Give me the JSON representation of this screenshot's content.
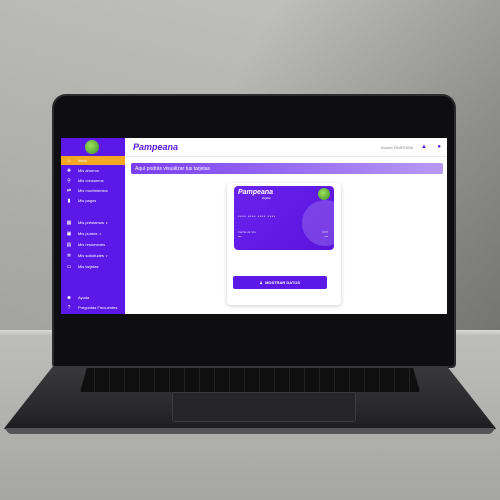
{
  "app": {
    "brand": "Pampeana",
    "user_name": "Usuario PAMPEANA"
  },
  "sidebar": {
    "items": [
      {
        "label": "Inicio",
        "icon": "home-icon",
        "glyph": "⌂",
        "caret": ""
      },
      {
        "label": "Mis ahorros",
        "icon": "piggy-icon",
        "glyph": "✚",
        "caret": ""
      },
      {
        "label": "Mis consumos",
        "icon": "search-icon",
        "glyph": "⚲",
        "caret": ""
      },
      {
        "label": "Mis movimientos",
        "icon": "transfer-icon",
        "glyph": "⇄",
        "caret": ""
      },
      {
        "label": "Mis pagos",
        "icon": "receipt-icon",
        "glyph": "▮",
        "caret": ""
      },
      {
        "label": "Mis préstamos",
        "icon": "bank-icon",
        "glyph": "▦",
        "caret": "▾"
      },
      {
        "label": "Mis puntos",
        "icon": "gift-icon",
        "glyph": "▣",
        "caret": "▾"
      },
      {
        "label": "Mis resúmenes",
        "icon": "document-icon",
        "glyph": "▤",
        "caret": ""
      },
      {
        "label": "Mis solicitudes",
        "icon": "gear-icon",
        "glyph": "✲",
        "caret": "▾"
      },
      {
        "label": "Mis tarjetas",
        "icon": "card-icon",
        "glyph": "▭",
        "caret": ""
      }
    ],
    "bottom_items": [
      {
        "label": "Ayuda",
        "icon": "help-person-icon",
        "glyph": "☻"
      },
      {
        "label": "Preguntas Frecuentes",
        "icon": "question-icon",
        "glyph": "?"
      }
    ]
  },
  "main": {
    "banner_text": "Aquí podrás visualizar tus tarjetas"
  },
  "card": {
    "brand": "Pampeana",
    "sub": "Digital",
    "number": "**** **** **** ****",
    "exp_label": "Fecha de Vto",
    "exp_value": "***",
    "cvv_label": "CVV",
    "cvv_value": "***"
  },
  "actions": {
    "show_data": "MOSTRAR DATOS"
  },
  "colors": {
    "primary": "#5c18e6",
    "accent": "#f5a623"
  }
}
